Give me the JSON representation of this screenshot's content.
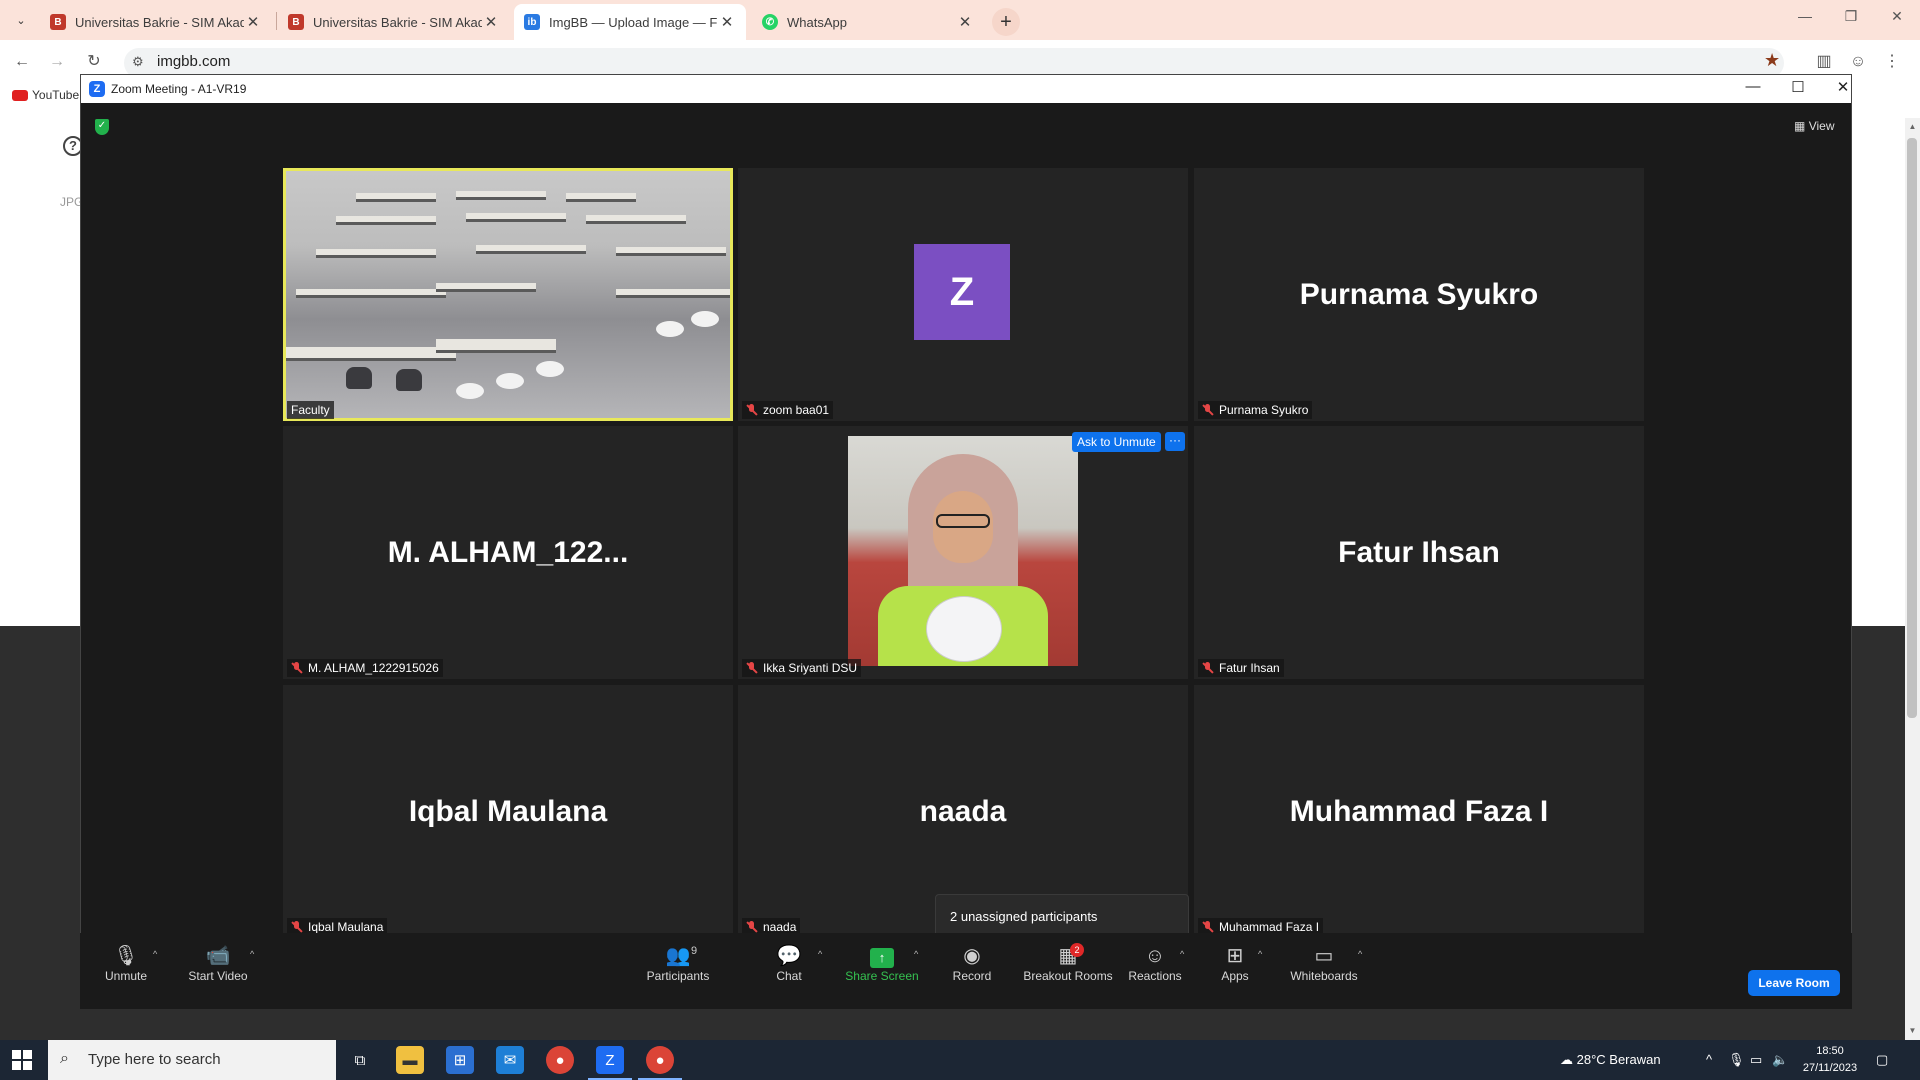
{
  "browser": {
    "tabs": [
      {
        "title": "Universitas Bakrie - SIM Akadem",
        "icon": "bakrie-favicon"
      },
      {
        "title": "Universitas Bakrie - SIM Akadem",
        "icon": "bakrie-favicon"
      },
      {
        "title": "ImgBB — Upload Image — Free",
        "icon": "imgbb-favicon"
      },
      {
        "title": "WhatsApp",
        "icon": "whatsapp-favicon"
      }
    ],
    "url": "imgbb.com",
    "bookmark": "YouTube",
    "page_text": "JPG"
  },
  "zoom": {
    "window_title": "Zoom Meeting - A1-VR19",
    "view_label": "View",
    "tiles": [
      {
        "big_name": "",
        "tag": "Faculty",
        "muted": false
      },
      {
        "big_name": "",
        "avatar_letter": "Z",
        "tag": "zoom baa01",
        "muted": true
      },
      {
        "big_name": "Purnama Syukro",
        "tag": "Purnama Syukro",
        "muted": true
      },
      {
        "big_name": "M.  ALHAM_122...",
        "tag": "M. ALHAM_1222915026",
        "muted": true
      },
      {
        "big_name": "",
        "tag": "Ikka Sriyanti DSU",
        "muted": true
      },
      {
        "big_name": "Fatur Ihsan",
        "tag": "Fatur Ihsan",
        "muted": true
      },
      {
        "big_name": "Iqbal Maulana",
        "tag": "Iqbal Maulana",
        "muted": true
      },
      {
        "big_name": "naada",
        "tag": "naada",
        "muted": true
      },
      {
        "big_name": "Muhammad Faza I",
        "tag": "Muhammad Faza I",
        "muted": true
      }
    ],
    "ask_to_unmute": "Ask to Unmute",
    "more": "···",
    "tooltip": "2 unassigned participants",
    "controls": {
      "unmute": "Unmute",
      "start_video": "Start Video",
      "participants": "Participants",
      "participants_count": "9",
      "chat": "Chat",
      "share_screen": "Share Screen",
      "record": "Record",
      "breakout_rooms": "Breakout Rooms",
      "breakout_badge": "2",
      "reactions": "Reactions",
      "apps": "Apps",
      "whiteboards": "Whiteboards",
      "leave": "Leave Room"
    },
    "colors": {
      "accent": "#0e72ed",
      "share": "#22b14c",
      "speaker_border": "#e8e85a",
      "avatar": "#7b4fc2"
    }
  },
  "taskbar": {
    "search_placeholder": "Type here to search",
    "weather": "28°C  Berawan",
    "time": "18:50",
    "date": "27/11/2023"
  }
}
